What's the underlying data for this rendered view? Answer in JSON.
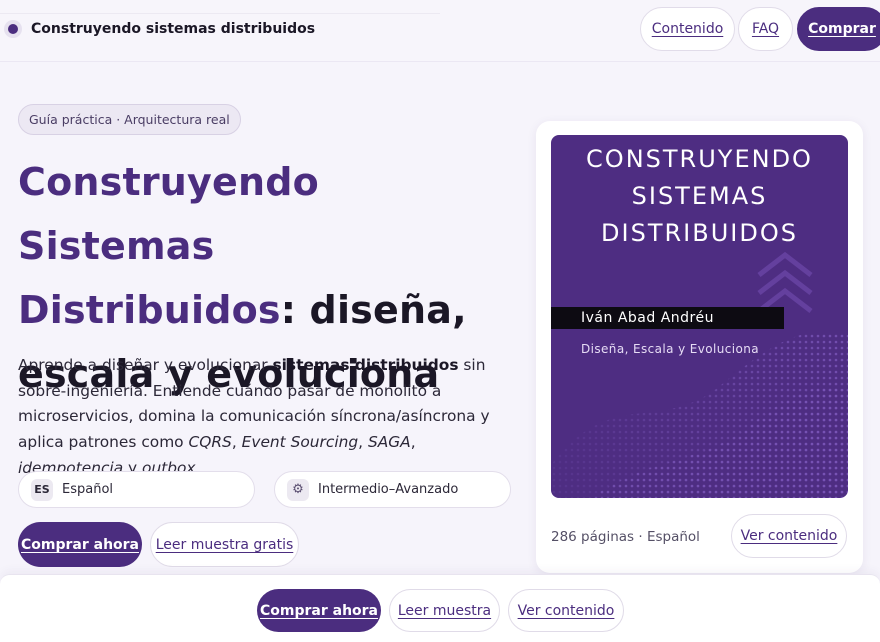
{
  "header": {
    "brand_title": "Construyendo sistemas distribuidos",
    "nav": {
      "contenido": "Contenido",
      "faq": "FAQ",
      "comprar": "Comprar"
    }
  },
  "hero": {
    "pill": "Guía práctica · Arquitectura real",
    "headline": {
      "accent_line1": "Construyendo Sistemas",
      "accent_line2": "Distribuidos",
      "rest_line2": ": diseña,",
      "line3": "escala y evoluciona"
    },
    "intro": {
      "p1": "Aprende a diseñar y evolucionar ",
      "b1": "sistemas distribuidos",
      "p2": " sin sobre-ingeniería. Entiende cuándo pasar de monolito a microservicios, domina la comunicación síncrona/asíncrona y aplica patrones como ",
      "i1": "CQRS",
      "p3": ", ",
      "i2": "Event Sourcing",
      "p4": ", ",
      "i3": "SAGA",
      "p5": ", ",
      "i4": "idempotencia",
      "p6": " y ",
      "i5": "outbox",
      "p7": "."
    },
    "chips": {
      "language_badge": "ES",
      "language": "Español",
      "level_icon": "gear-icon",
      "level": "Intermedio–Avanzado"
    },
    "cta": {
      "buy": "Comprar ahora",
      "sample": "Leer muestra gratis"
    }
  },
  "book_card": {
    "cover": {
      "title_line1": "CONSTRUYENDO",
      "title_line2": "SISTEMAS",
      "title_line3": "DISTRIBUIDOS",
      "author": "Iván Abad Andréu",
      "subtitle": "Diseña, Escala y Evoluciona"
    },
    "meta": "286 páginas · Español",
    "button": "Ver contenido"
  },
  "bottom_bar": {
    "buy": "Comprar ahora",
    "sample": "Leer muestra",
    "content": "Ver contenido"
  },
  "colors": {
    "accent": "#4b2d7f",
    "background": "#f6f4fb",
    "cover": "#4e2d82"
  }
}
